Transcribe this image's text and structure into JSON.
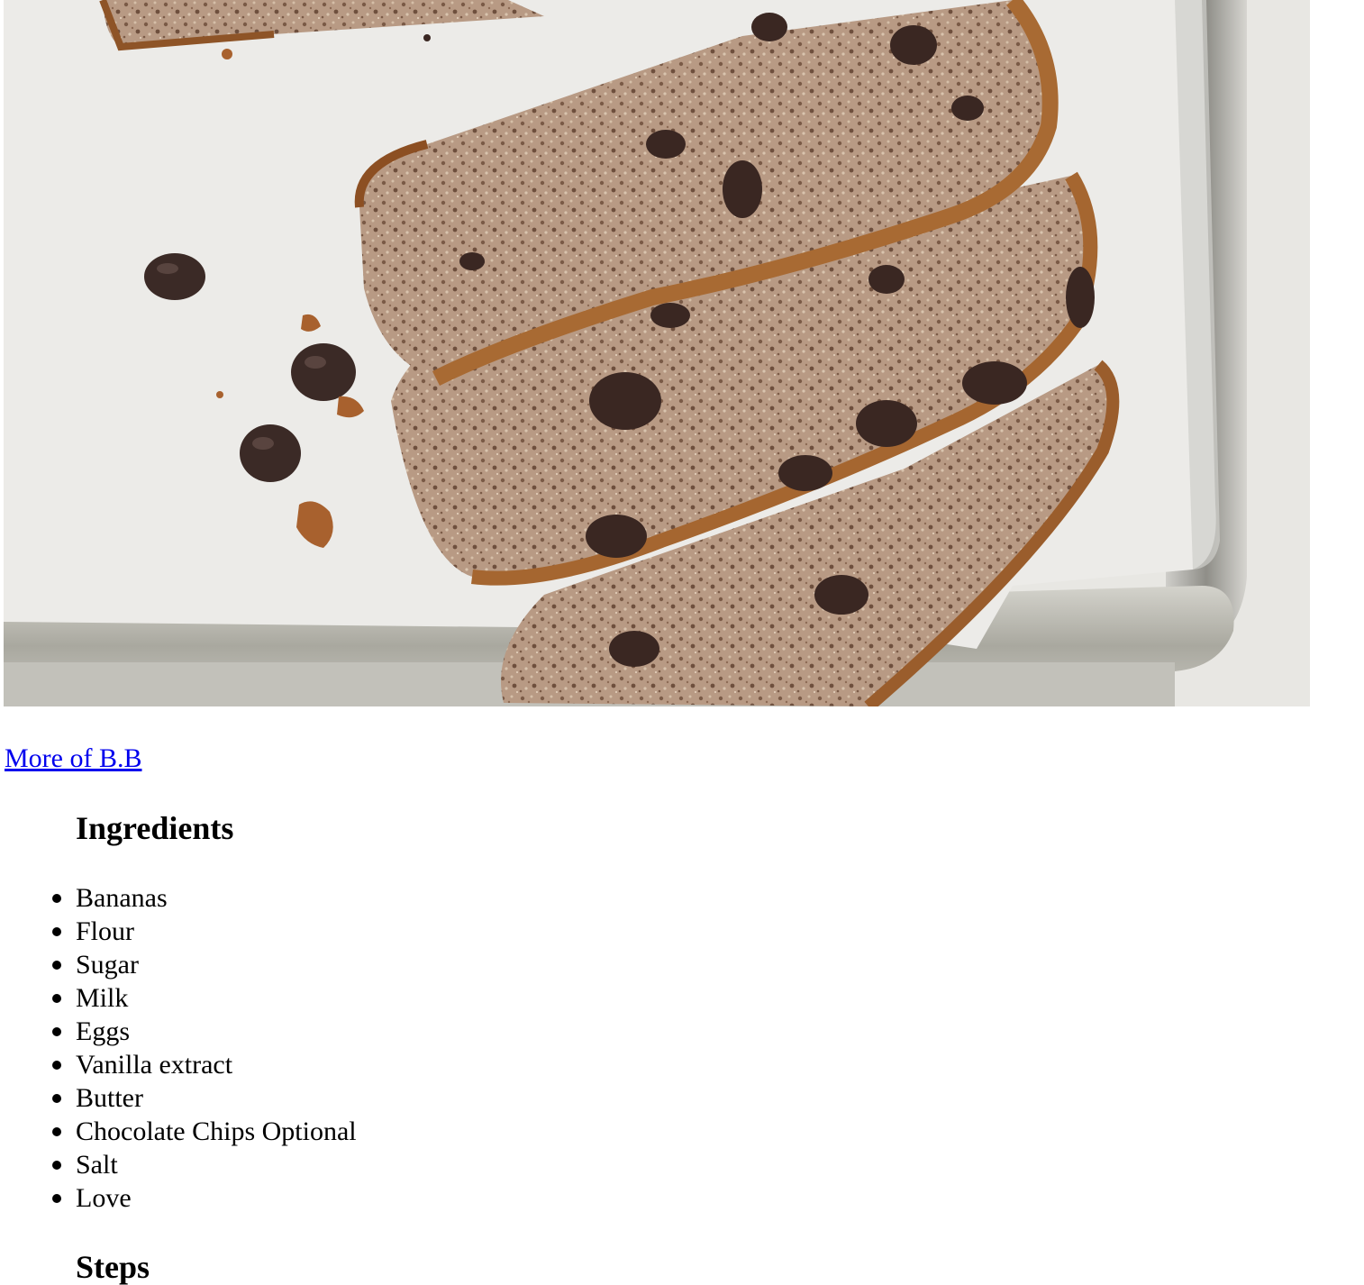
{
  "photo": {
    "subject": "banana bread slices with chocolate chips on parchment paper in a baking tray"
  },
  "link": {
    "label": "More of B.B"
  },
  "ingredients": {
    "heading": "Ingredients",
    "items": [
      "Bananas",
      "Flour",
      "Sugar",
      "Milk",
      "Eggs",
      "Vanilla extract",
      "Butter",
      "Chocolate Chips Optional",
      "Salt",
      "Love"
    ]
  },
  "steps": {
    "heading": "Steps"
  },
  "colors": {
    "link": "#0000ee",
    "text": "#000000",
    "parchment": "#ebebe8",
    "tray": "#b8b7ae",
    "bread_crumb": "#b89a82",
    "bread_crust": "#9a5d2c",
    "chocolate": "#3a2722"
  }
}
